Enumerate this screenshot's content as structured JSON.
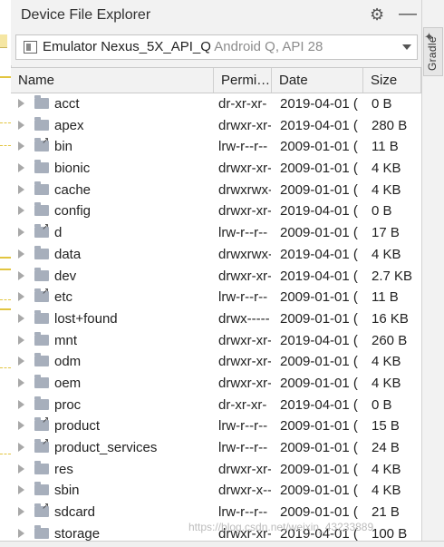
{
  "panel": {
    "title": "Device File Explorer",
    "side_tab_label": "Gradle"
  },
  "device": {
    "name": "Emulator Nexus_5X_API_Q",
    "sub": " Android Q, API 28"
  },
  "columns": [
    "Name",
    "Permi…",
    "Date",
    "Size"
  ],
  "rows": [
    {
      "name": "acct",
      "perm": "dr-xr-xr-",
      "date": "2019-04-01 (",
      "size": "0 B",
      "link": false
    },
    {
      "name": "apex",
      "perm": "drwxr-xr-",
      "date": "2019-04-01 (",
      "size": "280 B",
      "link": false
    },
    {
      "name": "bin",
      "perm": "lrw-r--r--",
      "date": "2009-01-01 (",
      "size": "11 B",
      "link": true
    },
    {
      "name": "bionic",
      "perm": "drwxr-xr-",
      "date": "2009-01-01 (",
      "size": "4 KB",
      "link": false
    },
    {
      "name": "cache",
      "perm": "drwxrwx-",
      "date": "2009-01-01 (",
      "size": "4 KB",
      "link": false
    },
    {
      "name": "config",
      "perm": "drwxr-xr-",
      "date": "2019-04-01 (",
      "size": "0 B",
      "link": false
    },
    {
      "name": "d",
      "perm": "lrw-r--r--",
      "date": "2009-01-01 (",
      "size": "17 B",
      "link": true
    },
    {
      "name": "data",
      "perm": "drwxrwx-",
      "date": "2019-04-01 (",
      "size": "4 KB",
      "link": false
    },
    {
      "name": "dev",
      "perm": "drwxr-xr-",
      "date": "2019-04-01 (",
      "size": "2.7 KB",
      "link": false
    },
    {
      "name": "etc",
      "perm": "lrw-r--r--",
      "date": "2009-01-01 (",
      "size": "11 B",
      "link": true
    },
    {
      "name": "lost+found",
      "perm": "drwx-----",
      "date": "2009-01-01 (",
      "size": "16 KB",
      "link": false
    },
    {
      "name": "mnt",
      "perm": "drwxr-xr-",
      "date": "2019-04-01 (",
      "size": "260 B",
      "link": false
    },
    {
      "name": "odm",
      "perm": "drwxr-xr-",
      "date": "2009-01-01 (",
      "size": "4 KB",
      "link": false
    },
    {
      "name": "oem",
      "perm": "drwxr-xr-",
      "date": "2009-01-01 (",
      "size": "4 KB",
      "link": false
    },
    {
      "name": "proc",
      "perm": "dr-xr-xr-",
      "date": "2019-04-01 (",
      "size": "0 B",
      "link": false
    },
    {
      "name": "product",
      "perm": "lrw-r--r--",
      "date": "2009-01-01 (",
      "size": "15 B",
      "link": true
    },
    {
      "name": "product_services",
      "perm": "lrw-r--r--",
      "date": "2009-01-01 (",
      "size": "24 B",
      "link": true
    },
    {
      "name": "res",
      "perm": "drwxr-xr-",
      "date": "2009-01-01 (",
      "size": "4 KB",
      "link": false
    },
    {
      "name": "sbin",
      "perm": "drwxr-x--",
      "date": "2009-01-01 (",
      "size": "4 KB",
      "link": false
    },
    {
      "name": "sdcard",
      "perm": "lrw-r--r--",
      "date": "2009-01-01 (",
      "size": "21 B",
      "link": true
    },
    {
      "name": "storage",
      "perm": "drwxr-xr-",
      "date": "2019-04-01 (",
      "size": "100 B",
      "link": false
    }
  ],
  "watermark": "https://blog.csdn.net/weixin_43233889",
  "icons": {
    "settings": "gear-icon",
    "minimize": "minimize-icon",
    "dropdown": "chevron-down-icon",
    "folder": "folder-icon",
    "symlink": "symlink-arrow-icon",
    "expand": "expand-arrow-icon"
  },
  "colors": {
    "folder": "#a7afbc",
    "background": "#f2f2f2",
    "table_bg": "#ffffff"
  }
}
